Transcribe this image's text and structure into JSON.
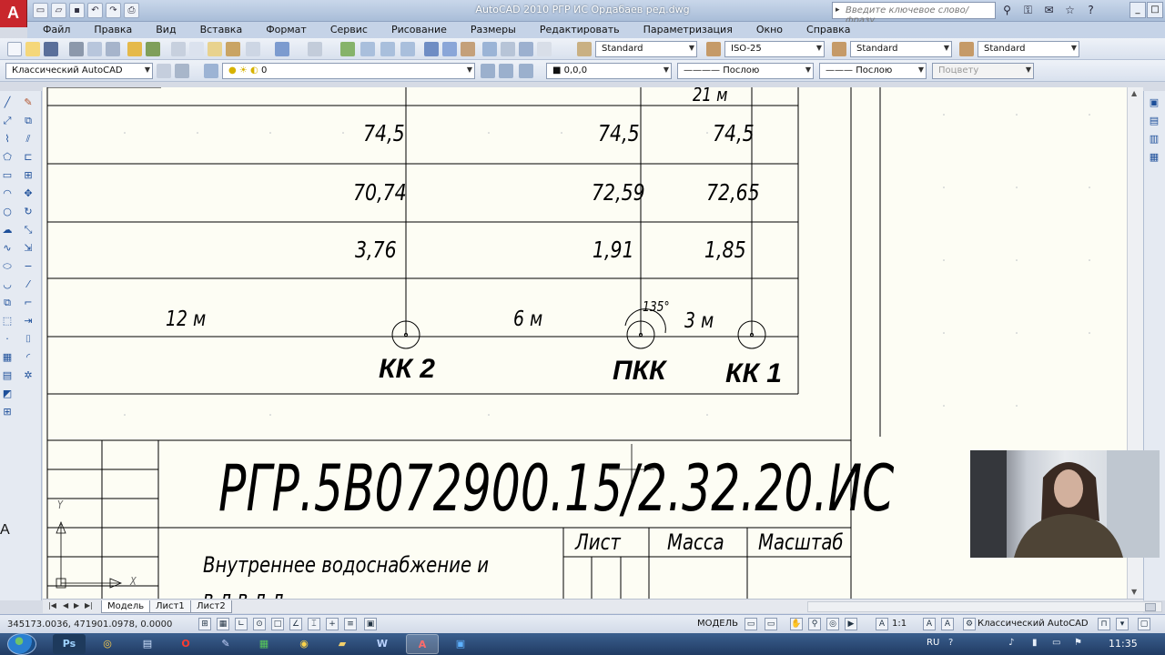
{
  "window": {
    "logo_letter": "A",
    "title": "AutoCAD 2010      РГР ИС Ордабаев ред.dwg",
    "search_placeholder": "Введите ключевое слово/фразу"
  },
  "menu": [
    "Файл",
    "Правка",
    "Вид",
    "Вставка",
    "Формат",
    "Сервис",
    "Рисование",
    "Размеры",
    "Редактировать",
    "Параметризация",
    "Окно",
    "Справка"
  ],
  "toolbar_styles": {
    "text_style": "Standard",
    "dim_style": "ISO-25",
    "table_style": "Standard",
    "mleader_style": "Standard"
  },
  "toolbar_layers": {
    "workspace": "Классический AutoCAD",
    "layer": "0",
    "color": "0,0,0",
    "linetype": "Послою",
    "lineweight": "Послою",
    "plotstyle": "Поцвету"
  },
  "drawing": {
    "row_ground": [
      "74,5",
      "74,5",
      "74,5"
    ],
    "row_pipe": [
      "70,74",
      "72,59",
      "72,65"
    ],
    "row_depth": [
      "3,76",
      "1,91",
      "1,85"
    ],
    "top_cut_label": "21 м",
    "distances": [
      "12 м",
      "6 м",
      "3 м"
    ],
    "angle": "135°",
    "wells": [
      "КК 2",
      "ПКК",
      "КК 1"
    ],
    "stamp_code": "РГР.5В072900.15/2.32.20.ИС",
    "stamp_headers": [
      "Лист",
      "Масса",
      "Масштаб"
    ],
    "stamp_title": "Внутреннее водоснабжение и",
    "stamp_title_cut": "в   д      в   д          д",
    "ucs_y": "Y",
    "ucs_x": "X"
  },
  "layout_tabs": [
    "Модель",
    "Лист1",
    "Лист2"
  ],
  "status": {
    "coords": "345173.0036, 471901.0978, 0.0000",
    "mode_label": "МОДЕЛЬ",
    "scale": "1:1",
    "workspace": "Классический AutoCAD"
  },
  "taskbar": {
    "apps": [
      "Ps",
      "Opera",
      "Files",
      "Notes",
      "Excel",
      "Chrome",
      "Explorer",
      "Word",
      "AutoCAD",
      "Zoom"
    ],
    "lang": "RU",
    "clock": "11:35"
  },
  "colors": {
    "drawing_bg": "#fdfdf4",
    "logo_red": "#c8262c",
    "taskbar": "#2b4a78"
  }
}
